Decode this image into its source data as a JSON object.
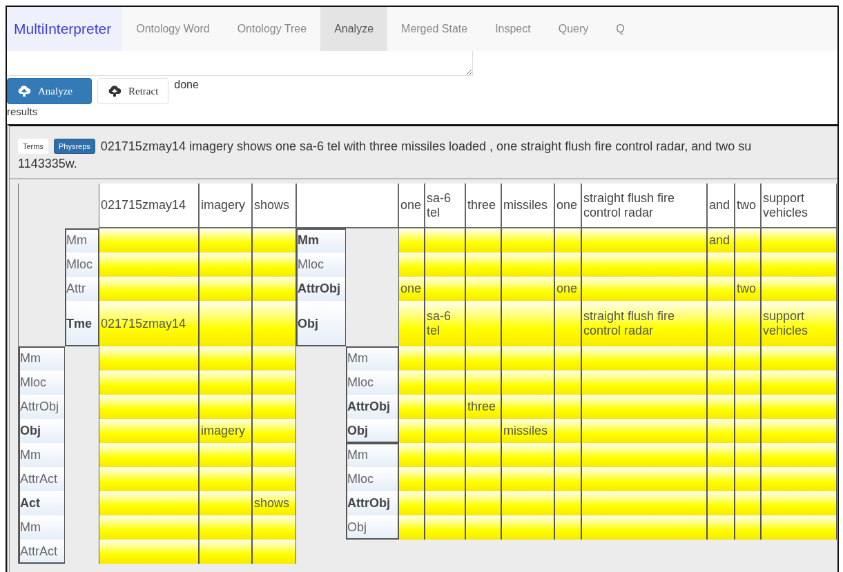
{
  "navbar": {
    "brand": "MultiInterpreter",
    "tabs": [
      {
        "label": "Ontology Word",
        "selected": false
      },
      {
        "label": "Ontology Tree",
        "selected": false
      },
      {
        "label": "Analyze",
        "selected": true
      },
      {
        "label": "Merged State",
        "selected": false
      },
      {
        "label": "Inspect",
        "selected": false
      },
      {
        "label": "Query",
        "selected": false
      },
      {
        "label": "Q",
        "selected": false
      }
    ]
  },
  "actions": {
    "buttons": [
      {
        "label": "Analyze",
        "kind": "primary"
      },
      {
        "label": "Retract",
        "kind": "default"
      }
    ],
    "status": "done"
  },
  "results_label": "results",
  "results": {
    "views": [
      {
        "label": "Terms",
        "selected": false
      },
      {
        "label": "Physreps",
        "selected": true
      }
    ],
    "sentence": "021715zmay14 imagery shows one sa-6 tel with three missiles loaded , one straight flush fire control radar, and two su",
    "sentence_continued": "1143335w.",
    "table": {
      "left_columns": [
        "021715zmay14",
        "imagery",
        "shows"
      ],
      "right_columns": [
        "one",
        "sa-6 tel",
        "three",
        "missiles",
        "one",
        "straight flush fire control radar",
        "and",
        "two",
        "support vehicles"
      ],
      "frames": [
        {
          "kind": "upper_left",
          "rows": [
            {
              "label": "Mm",
              "bold": false,
              "cells": [
                null,
                null,
                null
              ]
            },
            {
              "label": "Mloc",
              "bold": false,
              "cells": [
                null,
                null,
                null
              ]
            },
            {
              "label": "Attr",
              "bold": false,
              "cells": [
                null,
                null,
                null
              ]
            },
            {
              "label": "Tme",
              "bold": true,
              "cells": [
                "021715zmay14",
                null,
                null
              ]
            }
          ]
        },
        {
          "kind": "upper_right",
          "rows": [
            {
              "label": "Mm",
              "bold": true,
              "cells": [
                null,
                null,
                null,
                null,
                null,
                null,
                "and",
                null,
                null
              ]
            },
            {
              "label": "Mloc",
              "bold": false,
              "cells": [
                null,
                null,
                null,
                null,
                null,
                null,
                null,
                null,
                null
              ]
            },
            {
              "label": "AttrObj",
              "bold": true,
              "cells": [
                "one",
                null,
                null,
                null,
                "one",
                null,
                null,
                "two",
                null
              ]
            },
            {
              "label": "Obj",
              "bold": true,
              "cells": [
                null,
                "sa-6 tel",
                null,
                null,
                null,
                "straight flush fire control radar",
                null,
                null,
                "support vehicles"
              ]
            }
          ]
        },
        {
          "kind": "lower_left",
          "rows": [
            {
              "label": "Mm",
              "bold": false,
              "cells": [
                null,
                null,
                null
              ]
            },
            {
              "label": "Mloc",
              "bold": false,
              "cells": [
                null,
                null,
                null
              ]
            },
            {
              "label": "AttrObj",
              "bold": false,
              "cells": [
                null,
                null,
                null
              ]
            },
            {
              "label": "Obj",
              "bold": true,
              "cells": [
                null,
                "imagery",
                null
              ]
            },
            {
              "label": "Mm",
              "bold": false,
              "cells": [
                null,
                null,
                null
              ]
            },
            {
              "label": "AttrAct",
              "bold": false,
              "cells": [
                null,
                null,
                null
              ]
            },
            {
              "label": "Act",
              "bold": true,
              "cells": [
                null,
                null,
                "shows"
              ]
            },
            {
              "label": "Mm",
              "bold": false,
              "cells": [
                null,
                null,
                null
              ]
            },
            {
              "label": "AttrAct",
              "bold": false,
              "cells": [
                null,
                null,
                null
              ]
            }
          ]
        },
        {
          "kind": "lower_right",
          "rows": [
            {
              "label": "Mm",
              "bold": false,
              "cells": [
                null,
                null,
                null,
                null,
                null,
                null,
                null,
                null,
                null
              ]
            },
            {
              "label": "Mloc",
              "bold": false,
              "cells": [
                null,
                null,
                null,
                null,
                null,
                null,
                null,
                null,
                null
              ]
            },
            {
              "label": "AttrObj",
              "bold": true,
              "cells": [
                null,
                null,
                "three",
                null,
                null,
                null,
                null,
                null,
                null
              ]
            },
            {
              "label": "Obj",
              "bold": true,
              "cells": [
                null,
                null,
                null,
                "missiles",
                null,
                null,
                null,
                null,
                null
              ]
            }
          ]
        },
        {
          "kind": "lower_right",
          "rows": [
            {
              "label": "Mm",
              "bold": false,
              "cells": [
                null,
                null,
                null,
                null,
                null,
                null,
                null,
                null,
                null
              ]
            },
            {
              "label": "Mloc",
              "bold": false,
              "cells": [
                null,
                null,
                null,
                null,
                null,
                null,
                null,
                null,
                null
              ]
            },
            {
              "label": "AttrObj",
              "bold": true,
              "cells": [
                null,
                null,
                null,
                null,
                null,
                null,
                null,
                null,
                null
              ]
            },
            {
              "label": "Obj",
              "bold": false,
              "cells": [
                null,
                null,
                null,
                null,
                null,
                null,
                null,
                null,
                null
              ]
            }
          ]
        }
      ]
    }
  }
}
